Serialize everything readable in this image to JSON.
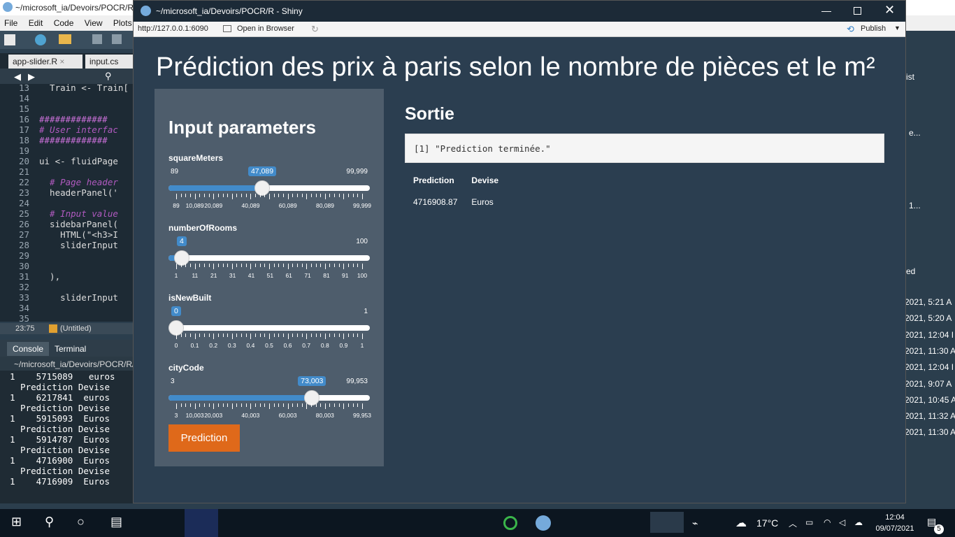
{
  "rstudio": {
    "title": "~/microsoft_ia/Devoirs/POCR/R",
    "menu": [
      "File",
      "Edit",
      "Code",
      "View",
      "Plots"
    ],
    "tabs": [
      "app-slider.R",
      "input.cs"
    ],
    "editor_lines": [
      {
        "n": "13",
        "code": "  Train <- Train["
      },
      {
        "n": "14",
        "code": ""
      },
      {
        "n": "15",
        "code": ""
      },
      {
        "n": "16",
        "code": "#############"
      },
      {
        "n": "17",
        "code": "# User interfac"
      },
      {
        "n": "18",
        "code": "#############"
      },
      {
        "n": "19",
        "code": ""
      },
      {
        "n": "20",
        "code": "ui <- fluidPage"
      },
      {
        "n": "21",
        "code": ""
      },
      {
        "n": "22",
        "code": "  # Page header"
      },
      {
        "n": "23",
        "code": "  headerPanel('"
      },
      {
        "n": "24",
        "code": ""
      },
      {
        "n": "25",
        "code": "  # Input value"
      },
      {
        "n": "26",
        "code": "  sidebarPanel("
      },
      {
        "n": "27",
        "code": "    HTML(\"<h3>I"
      },
      {
        "n": "28",
        "code": "    sliderInput"
      },
      {
        "n": "29",
        "code": ""
      },
      {
        "n": "30",
        "code": ""
      },
      {
        "n": "31",
        "code": "  ),"
      },
      {
        "n": "32",
        "code": ""
      },
      {
        "n": "33",
        "code": "    sliderInput"
      },
      {
        "n": "34",
        "code": ""
      },
      {
        "n": "35",
        "code": ""
      }
    ],
    "status_pos": "23:75",
    "status_scope": "(Untitled)",
    "console_tabs": [
      "Console",
      "Terminal"
    ],
    "console_path": "~/microsoft_ia/Devoirs/POCR/R/",
    "console_lines": [
      "1    5715089   euros",
      "  Prediction Devise",
      "1    6217841  euros",
      "  Prediction Devise",
      "1    5915093  Euros",
      "  Prediction Devise",
      "1    5914787  Euros",
      "  Prediction Devise",
      "1    4716900  Euros",
      "  Prediction Devise",
      "1    4716909  Euros"
    ],
    "right_pane_texts": [
      "ist",
      "e...",
      "1...",
      "ed"
    ],
    "right_pane_times": [
      "2021, 5:21 A",
      "2021, 5:20 A",
      "2021, 12:04 I",
      "2021, 11:30 A",
      "2021, 12:04 I",
      "2021, 9:07 A",
      "2021, 10:45 A",
      "2021, 11:32 A",
      "2021, 11:30 A"
    ]
  },
  "shiny": {
    "window_title": "~/microsoft_ia/Devoirs/POCR/R - Shiny",
    "url": "http://127.0.0.1:6090",
    "open_browser": "Open in Browser",
    "publish": "Publish",
    "app_title": "Prédiction des prix à paris selon le nombre de pièces et le m²",
    "sidebar_title": "Input parameters",
    "sliders": [
      {
        "label": "squareMeters",
        "min": "89",
        "max": "99,999",
        "value": "47,089",
        "fraction": 0.4623,
        "ticks": [
          "89",
          "10,089",
          "20,089",
          "40,089",
          "60,089",
          "80,089",
          "99,999"
        ],
        "tick_fracs": [
          0,
          0.1001,
          0.2002,
          0.4004,
          0.6006,
          0.8008,
          1
        ]
      },
      {
        "label": "numberOfRooms",
        "min": "",
        "max": "100",
        "value": "4",
        "fraction": 0.0303,
        "ticks": [
          "1",
          "11",
          "21",
          "31",
          "41",
          "51",
          "61",
          "71",
          "81",
          "91",
          "100"
        ],
        "tick_fracs": [
          0,
          0.101,
          0.202,
          0.303,
          0.404,
          0.505,
          0.606,
          0.707,
          0.808,
          0.909,
          1
        ]
      },
      {
        "label": "isNewBuilt",
        "min": "",
        "max": "1",
        "value": "0",
        "fraction": 0,
        "ticks": [
          "0",
          "0.1",
          "0.2",
          "0.3",
          "0.4",
          "0.5",
          "0.6",
          "0.7",
          "0.8",
          "0.9",
          "1"
        ],
        "tick_fracs": [
          0,
          0.1,
          0.2,
          0.3,
          0.4,
          0.5,
          0.6,
          0.7,
          0.8,
          0.9,
          1
        ]
      },
      {
        "label": "cityCode",
        "min": "3",
        "max": "99,953",
        "value": "73,003",
        "fraction": 0.7304,
        "ticks": [
          "3",
          "10,003",
          "20,003",
          "40,003",
          "60,003",
          "80,003",
          "99,953"
        ],
        "tick_fracs": [
          0,
          0.1,
          0.2,
          0.4,
          0.6,
          0.8,
          1
        ]
      }
    ],
    "predict_button": "Prediction",
    "output_title": "Sortie",
    "output_text": "[1] \"Prediction terminée.\"",
    "table": {
      "headers": [
        "Prediction",
        "Devise"
      ],
      "rows": [
        [
          "4716908.87",
          "Euros"
        ]
      ]
    }
  },
  "taskbar": {
    "temperature": "17°C",
    "time": "12:04",
    "date": "09/07/2021",
    "notifications": "5"
  },
  "colors": {
    "shiny_bg": "#2b3e50",
    "sidebar_bg": "#4e5d6c",
    "accent_blue": "#428bca",
    "button_orange": "#df691a"
  }
}
